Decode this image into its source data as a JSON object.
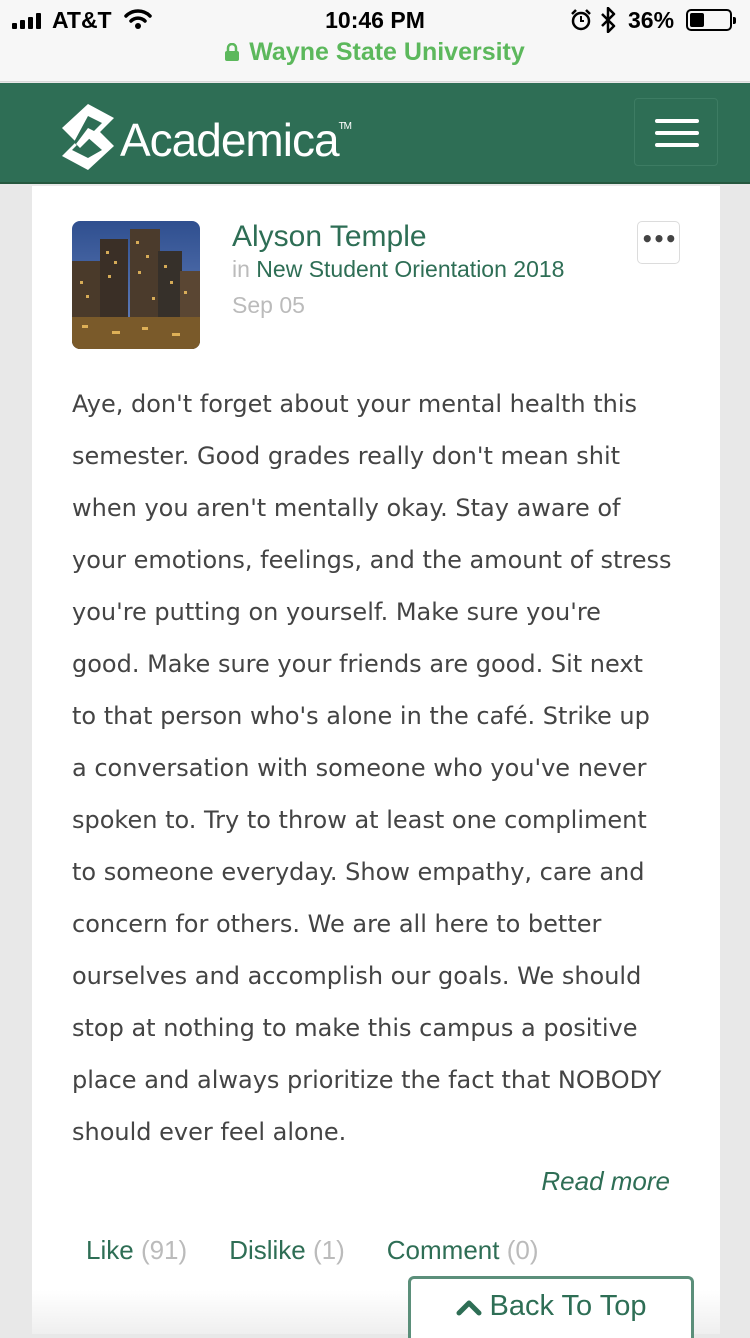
{
  "status_bar": {
    "carrier": "AT&T",
    "time": "10:46 PM",
    "battery_percent": "36%",
    "battery_level": 0.36,
    "site": "Wayne State University",
    "icons": [
      "signal-icon",
      "wifi-icon",
      "alarm-icon",
      "bluetooth-icon",
      "battery-icon",
      "lock-icon"
    ]
  },
  "header": {
    "brand": "Academica",
    "trademark": "TM",
    "icons": [
      "academica-logo-icon",
      "hamburger-menu-icon"
    ]
  },
  "post": {
    "author": "Alyson Temple",
    "in_label": "in",
    "group": "New Student Orientation 2018",
    "date": "Sep 05",
    "options_label": "•••",
    "body": "Aye, don't forget about your mental health this semester. Good grades really don't mean shit when you aren't mentally okay. Stay aware of your emotions, feelings, and the amount of stress you're putting on yourself. Make sure you're good. Make sure your friends are good. Sit next to that person who's alone in the café. Strike up a conversation with someone who you've never spoken to. Try to throw at least one compliment to someone everyday. Show empathy, care and concern for others. We are all here to better ourselves and accomplish our goals. We should stop at nothing to make this campus a positive place and always prioritize the fact that NOBODY should ever feel alone.",
    "read_more": "Read more",
    "actions": {
      "like_label": "Like",
      "like_count": "(91)",
      "dislike_label": "Dislike",
      "dislike_count": "(1)",
      "comment_label": "Comment",
      "comment_count": "(0)"
    }
  },
  "back_to_top": "Back To Top",
  "colors": {
    "brand_green": "#2e6e55",
    "url_green": "#5cb85c",
    "muted": "#bbbbbb",
    "body_text": "#444444"
  }
}
